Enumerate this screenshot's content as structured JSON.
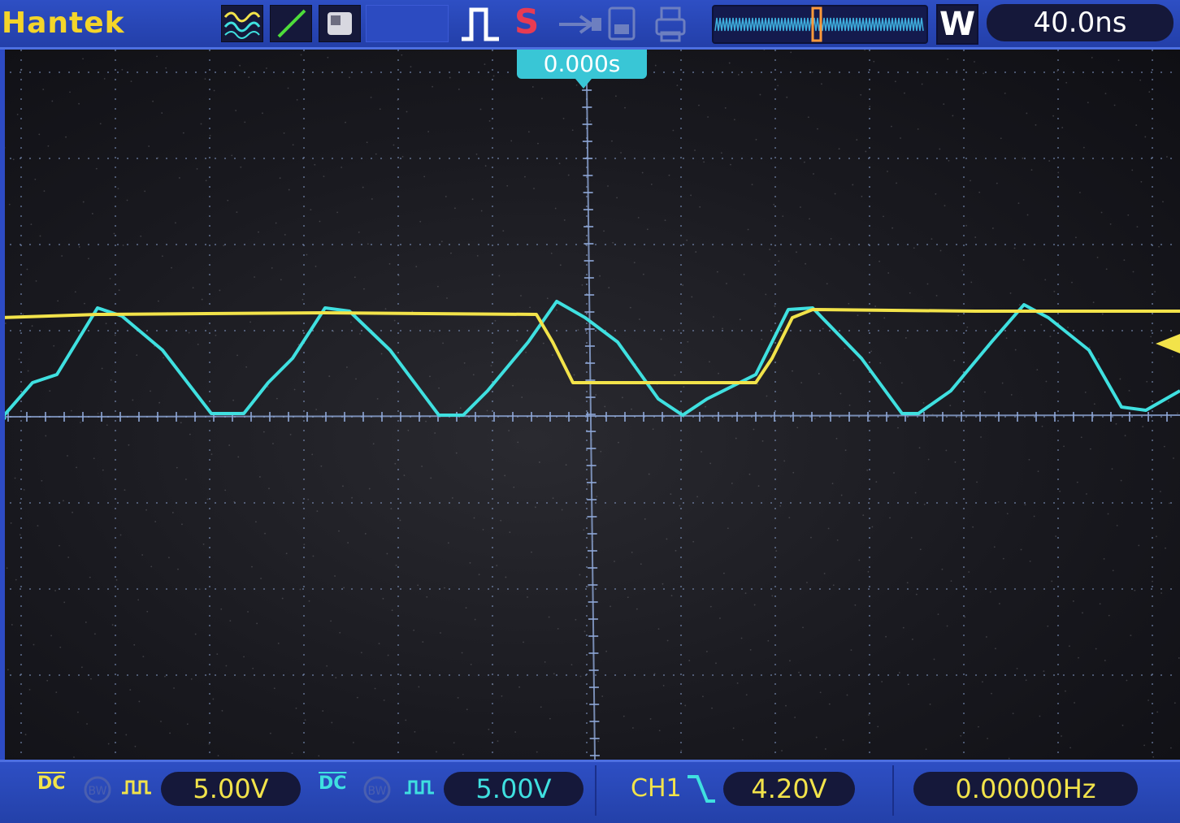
{
  "topbar": {
    "brand": "Hantek",
    "stop_indicator": "S",
    "window_mode": "W",
    "timebase": "40.0ns",
    "icons": [
      "waveform-icon",
      "line-icon",
      "persistence-icon",
      "single-pulse-icon",
      "usb-icon",
      "save-icon",
      "print-icon"
    ]
  },
  "display": {
    "trigger_position": "0.000s",
    "colors": {
      "ch1": "#f2e34a",
      "ch2": "#3fe0e0",
      "grid": "#8fa8d8",
      "accent": "#39c6d6"
    }
  },
  "bottombar": {
    "ch1": {
      "coupling": "DC",
      "volts_per_div": "5.00V"
    },
    "ch2": {
      "coupling": "DC",
      "volts_per_div": "5.00V"
    },
    "trigger": {
      "source": "CH1",
      "slope": "falling",
      "level": "4.20V"
    },
    "frequency": "0.00000Hz"
  }
}
